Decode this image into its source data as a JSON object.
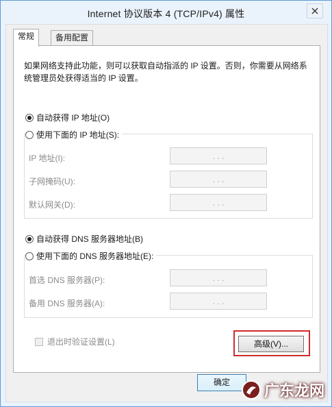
{
  "window": {
    "title": "Internet 协议版本 4 (TCP/IPv4) 属性"
  },
  "tabs": [
    {
      "label": "常规",
      "active": true
    },
    {
      "label": "备用配置",
      "active": false
    }
  ],
  "description": "如果网络支持此功能，则可以获取自动指派的 IP 设置。否则，你需要从网络系统管理员处获得适当的 IP 设置。",
  "ip_section": {
    "auto_label": "自动获得 IP 地址(O)",
    "auto_selected": true,
    "manual_label": "使用下面的 IP 地址(S):",
    "fields": [
      {
        "label": "IP 地址(I):",
        "value": ".   .   ."
      },
      {
        "label": "子网掩码(U):",
        "value": ".   .   ."
      },
      {
        "label": "默认网关(D):",
        "value": ".   .   ."
      }
    ]
  },
  "dns_section": {
    "auto_label": "自动获得 DNS 服务器地址(B)",
    "auto_selected": true,
    "manual_label": "使用下面的 DNS 服务器地址(E):",
    "fields": [
      {
        "label": "首选 DNS 服务器(P):",
        "value": ".   .   ."
      },
      {
        "label": "备用 DNS 服务器(A):",
        "value": ".   .   ."
      }
    ]
  },
  "validate_checkbox": {
    "label": "退出时验证设置(L)",
    "checked": false,
    "enabled": false
  },
  "advanced_button": "高级(V)...",
  "ok_button": "确定",
  "watermark": "广东龙网"
}
